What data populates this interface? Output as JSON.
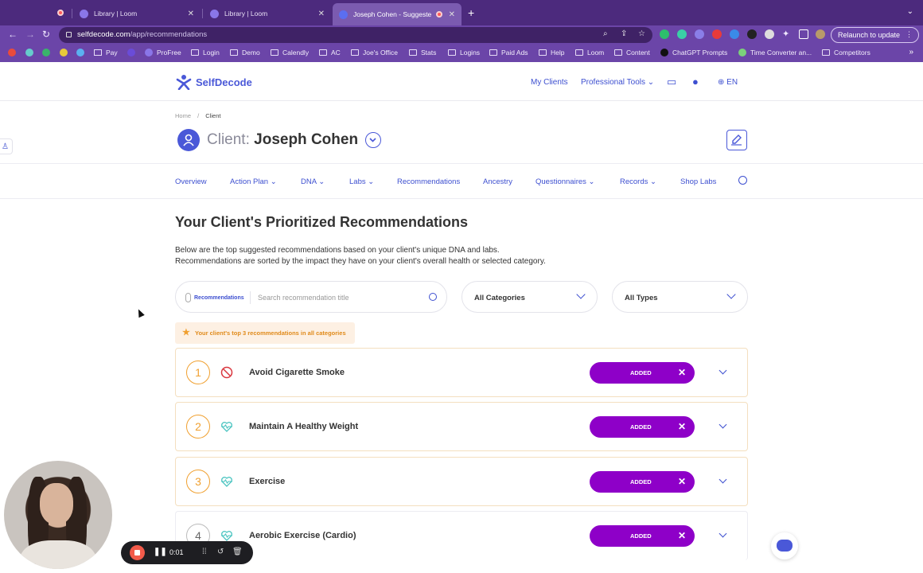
{
  "browser": {
    "tabs": [
      {
        "title": "Library | Loom",
        "active": false
      },
      {
        "title": "Library | Loom",
        "active": false
      },
      {
        "title": "Joseph Cohen - Suggeste",
        "active": true
      }
    ],
    "url_domain": "selfdecode.com",
    "url_path": "/app/recommendations",
    "relaunch_label": "Relaunch to update",
    "bookmarks": [
      "Pay",
      "ProFree",
      "Login",
      "Demo",
      "Calendly",
      "AC",
      "Joe's Office",
      "Stats",
      "Logins",
      "Paid Ads",
      "Help",
      "Loom",
      "Content",
      "ChatGPT Prompts",
      "Time Converter an...",
      "Competitors"
    ]
  },
  "header": {
    "brand": "SelfDecode",
    "my_clients": "My Clients",
    "professional_tools": "Professional Tools",
    "language": "EN"
  },
  "breadcrumb": {
    "home": "Home",
    "separator": "/",
    "current": "Client"
  },
  "client": {
    "prefix": "Client:",
    "name": "Joseph Cohen"
  },
  "subnav": [
    "Overview",
    "Action Plan",
    "DNA",
    "Labs",
    "Recommendations",
    "Ancestry",
    "Questionnaires",
    "Records",
    "Shop Labs"
  ],
  "page": {
    "title": "Your Client's Prioritized Recommendations",
    "intro_line1": "Below are the top suggested recommendations based on your client's unique DNA and labs.",
    "intro_line2": "Recommendations are sorted by the impact they have on your client's overall health or selected category."
  },
  "filters": {
    "search_tag": "Recommendations",
    "search_placeholder": "Search recommendation title",
    "category": "All Categories",
    "type": "All Types"
  },
  "top3_note": "Your client's top 3 recommendations in all categories",
  "recommendations": [
    {
      "rank": "1",
      "title": "Avoid Cigarette Smoke",
      "status": "ADDED",
      "icon": "no-smoking-icon"
    },
    {
      "rank": "2",
      "title": "Maintain A Healthy Weight",
      "status": "ADDED",
      "icon": "heart-pulse-icon"
    },
    {
      "rank": "3",
      "title": "Exercise",
      "status": "ADDED",
      "icon": "heart-pulse-icon"
    },
    {
      "rank": "4",
      "title": "Aerobic Exercise (Cardio)",
      "status": "ADDED",
      "icon": "heart-pulse-icon"
    }
  ],
  "loom": {
    "elapsed": "0:01"
  },
  "colors": {
    "brand": "#4a58d8",
    "added": "#8e00c8",
    "accent_orange": "#f0a030",
    "chrome": "#6b45a8"
  }
}
